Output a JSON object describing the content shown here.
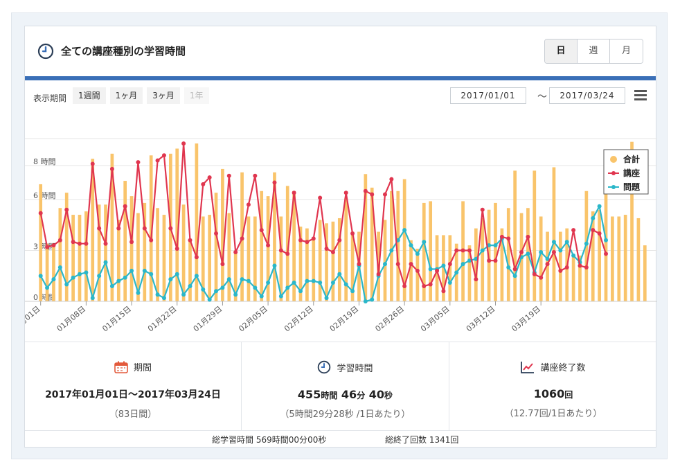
{
  "header": {
    "title": "全ての講座種別の学習時間",
    "title_icon": "clock-icon",
    "segments": [
      {
        "label": "日",
        "active": true
      },
      {
        "label": "週",
        "active": false
      },
      {
        "label": "月",
        "active": false
      }
    ]
  },
  "toolbar": {
    "period_label": "表示期間",
    "ranges": [
      {
        "label": "1週間",
        "disabled": false
      },
      {
        "label": "1ヶ月",
        "disabled": false
      },
      {
        "label": "3ヶ月",
        "disabled": false
      },
      {
        "label": "1年",
        "disabled": true
      }
    ],
    "date_from": "2017/01/01",
    "tilde": "〜",
    "date_to": "2017/03/24"
  },
  "colors": {
    "total": "#f9c46b",
    "course": "#e0364f",
    "problem": "#2ab7c9",
    "accent": "#3a6fb7"
  },
  "chart_data": {
    "type": "bar",
    "ylim": [
      0,
      10
    ],
    "y_ticks": [
      {
        "value": 0,
        "label": "0 時間"
      },
      {
        "value": 3,
        "label": "3 時間"
      },
      {
        "value": 6,
        "label": "6 時間"
      },
      {
        "value": 8,
        "label": "8 時間"
      }
    ],
    "x_ticks": [
      {
        "index": 0,
        "label": "01月01日"
      },
      {
        "index": 7,
        "label": "01月08日"
      },
      {
        "index": 14,
        "label": "01月15日"
      },
      {
        "index": 21,
        "label": "01月22日"
      },
      {
        "index": 28,
        "label": "01月29日"
      },
      {
        "index": 35,
        "label": "02月05日"
      },
      {
        "index": 42,
        "label": "02月12日"
      },
      {
        "index": 49,
        "label": "02月19日"
      },
      {
        "index": 56,
        "label": "02月26日"
      },
      {
        "index": 63,
        "label": "03月05日"
      },
      {
        "index": 70,
        "label": "03月12日"
      },
      {
        "index": 77,
        "label": "03月19日"
      }
    ],
    "legend_position": "top-right",
    "series": [
      {
        "name": "合計",
        "kind": "bar",
        "values": [
          6.9,
          3.4,
          3.4,
          5.5,
          6.4,
          5.1,
          5.1,
          5.3,
          8.4,
          5.7,
          5.7,
          8.7,
          4.8,
          7.1,
          6.2,
          5.2,
          5.8,
          8.6,
          5.5,
          5.1,
          8.7,
          9.0,
          5.7,
          3.6,
          9.3,
          5.0,
          5.1,
          6.4,
          7.8,
          5.2,
          3.0,
          7.6,
          5.0,
          5.0,
          6.5,
          6.2,
          7.6,
          5.0,
          6.8,
          6.5,
          4.4,
          4.3,
          3.6,
          4.8,
          4.6,
          4.7,
          4.9,
          6.1,
          4.1,
          4.1,
          7.5,
          6.7,
          4.1,
          4.8,
          6.5,
          6.5,
          7.2,
          3.6,
          3.1,
          5.8,
          5.9,
          3.9,
          3.9,
          3.9,
          3.4,
          5.9,
          3.3,
          4.3,
          4.9,
          5.4,
          5.8,
          4.3,
          5.5,
          7.7,
          5.2,
          5.5,
          7.7,
          5.0,
          4.1,
          7.9,
          4.1,
          4.3,
          2.7,
          2.7,
          6.5,
          5.3,
          5.4,
          6.8,
          5.0,
          5.0,
          5.1,
          9.4,
          4.9,
          3.3
        ]
      },
      {
        "name": "講座",
        "kind": "line",
        "values": [
          5.2,
          3.2,
          3.3,
          3.6,
          5.4,
          3.5,
          3.4,
          3.4,
          8.1,
          4.3,
          3.4,
          7.8,
          4.3,
          5.6,
          3.5,
          8.2,
          4.3,
          3.6,
          8.3,
          8.6,
          4.3,
          3.1,
          9.3,
          3.6,
          2.6,
          6.9,
          7.3,
          4.0,
          2.2,
          7.4,
          2.9,
          3.7,
          5.7,
          7.4,
          4.2,
          3.3,
          7.0,
          3.0,
          2.8,
          6.4,
          3.6,
          3.5,
          3.7,
          6.1,
          3.1,
          2.9,
          3.6,
          6.4,
          4.0,
          2.2,
          6.5,
          6.3,
          1.6,
          6.3,
          7.2,
          2.2,
          0.9,
          2.2,
          1.8,
          0.9,
          1.0,
          1.8,
          0.6,
          2.2,
          3.0,
          3.0,
          3.0,
          1.3,
          5.4,
          2.4,
          2.4,
          3.8,
          3.7,
          1.9,
          2.9,
          3.8,
          1.6,
          1.4,
          2.2,
          2.9,
          1.8,
          2.0,
          4.2,
          2.1,
          2.0,
          4.2,
          4.0,
          2.8
        ]
      },
      {
        "name": "問題",
        "kind": "line",
        "values": [
          1.5,
          0.8,
          1.3,
          2.0,
          1.0,
          1.4,
          1.6,
          1.7,
          0.2,
          1.5,
          2.3,
          0.9,
          1.2,
          1.4,
          1.8,
          0.5,
          1.8,
          1.6,
          0.4,
          0.2,
          1.3,
          1.6,
          0.4,
          0.9,
          1.5,
          0.7,
          0.1,
          0.6,
          0.8,
          1.3,
          0.4,
          1.3,
          1.2,
          0.8,
          0.3,
          1.1,
          2.1,
          0.3,
          0.8,
          1.1,
          0.6,
          1.2,
          1.2,
          1.1,
          0.2,
          1.1,
          1.6,
          1.0,
          0.6,
          2.1,
          0.0,
          0.1,
          1.5,
          2.2,
          3.0,
          3.6,
          4.2,
          3.3,
          2.8,
          3.5,
          1.9,
          1.9,
          2.1,
          1.1,
          1.7,
          2.2,
          2.4,
          2.5,
          3.0,
          3.3,
          3.3,
          3.7,
          2.0,
          1.5,
          2.6,
          2.8,
          1.7,
          2.9,
          2.5,
          3.5,
          3.0,
          3.5,
          2.7,
          2.3,
          3.4,
          4.9,
          5.6,
          3.6
        ]
      }
    ]
  },
  "stats": {
    "period": {
      "label": "期間",
      "icon": "calendar-icon",
      "main": "2017年01月01日〜2017年03月24日",
      "sub": "（83日間）"
    },
    "study": {
      "label": "学習時間",
      "icon": "clock-icon",
      "h": "455",
      "h_unit": "時間",
      "m": "46",
      "m_unit": "分",
      "s": "40",
      "s_unit": "秒",
      "sub": "（5時間29分28秒 /1日あたり）"
    },
    "completed": {
      "label": "講座終了数",
      "icon": "line-chart-icon",
      "count": "1060",
      "count_unit": "回",
      "sub": "（12.77回/1日あたり）"
    }
  },
  "footer": {
    "total_label": "総学習時間",
    "total_h": "569",
    "total_h_unit": "時間",
    "total_m": "00",
    "total_m_unit": "分",
    "total_s": "00",
    "total_s_unit": "秒",
    "count_label": "総終了回数",
    "count_value": "1341",
    "count_unit": "回"
  }
}
